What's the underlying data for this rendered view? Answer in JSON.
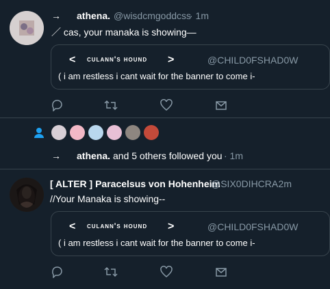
{
  "tweet1": {
    "arrow": "→",
    "display_name": "athena.",
    "handle": "@wisdcmgoddcss",
    "time": "· 1m",
    "text": "／ cas, your manaka is showing—",
    "quote": {
      "prev": "<",
      "name": "culann's hound",
      "next": ">",
      "handle": "@CHILD0FSHAD0W",
      "text": "(  i am restless i cant wait for the banner to come i-"
    }
  },
  "follow": {
    "arrow": "→",
    "display_name": "athena.",
    "text": "and 5 others followed you",
    "time": "· 1m"
  },
  "tweet2": {
    "display_name": "[ ALTER ] Paracelsus von Hohenheim",
    "handle": "@SIX0DIHCRA",
    "time": "· 2m",
    "text": "//Your Manaka is showing--",
    "quote": {
      "prev": "<",
      "name": "culann's hound",
      "next": ">",
      "handle": "@CHILD0FSHAD0W",
      "text": "(  i am restless i cant wait for the banner to come i-"
    }
  },
  "icons": {
    "reply": "reply-icon",
    "retweet": "retweet-icon",
    "like": "heart-icon",
    "dm": "mail-icon",
    "person": "person-icon"
  },
  "colors": {
    "background": "#15202b",
    "muted": "#8899a6",
    "border": "#38444d",
    "accent": "#1da1f2"
  }
}
